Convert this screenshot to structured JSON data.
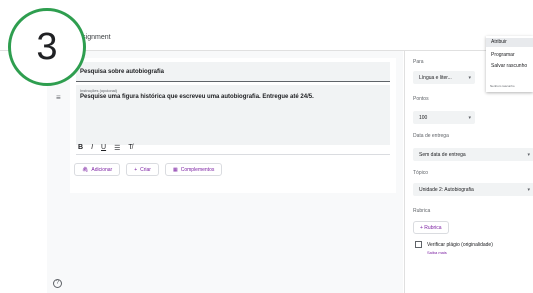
{
  "header": {
    "title": "Assignment"
  },
  "step": {
    "number": "3"
  },
  "form": {
    "title_value": "Pesquisa sobre autobiografia",
    "instructions_label": "Instruções (opcional)",
    "instructions_value": "Pesquise uma figura histórica que escreveu uma autobiografia. Entregue até 24/5.",
    "format_buttons": [
      "B",
      "I",
      "U",
      "☰",
      "T̸"
    ],
    "actions": [
      {
        "icon": "paperclip-icon",
        "glyph": "🖇",
        "label": "Adicionar"
      },
      {
        "icon": "plus-icon",
        "glyph": "+",
        "label": "Criar"
      },
      {
        "icon": "addons-icon",
        "glyph": "▦",
        "label": "Complementos"
      }
    ]
  },
  "sidebar": {
    "for_label": "Para",
    "for_value": "Língua e liter...",
    "points_label": "Pontos",
    "points_value": "100",
    "due_label": "Data de entrega",
    "due_value": "Sem data de entrega",
    "topic_label": "Tópico",
    "topic_value": "Unidade 2: Autobiografia",
    "rubric_label": "Rubrica",
    "rubric_button": "+ Rubrica",
    "plagiarism_label": "Verificar plágio (originalidade)",
    "learn_more": "Saiba mais"
  },
  "menu": {
    "items": [
      "Atribuir",
      "Programar",
      "Salvar rascunho"
    ],
    "subtext": "Nenhum rascunho"
  },
  "colors": {
    "accent": "#7b1fa2",
    "step_ring": "#2e9e4f"
  }
}
